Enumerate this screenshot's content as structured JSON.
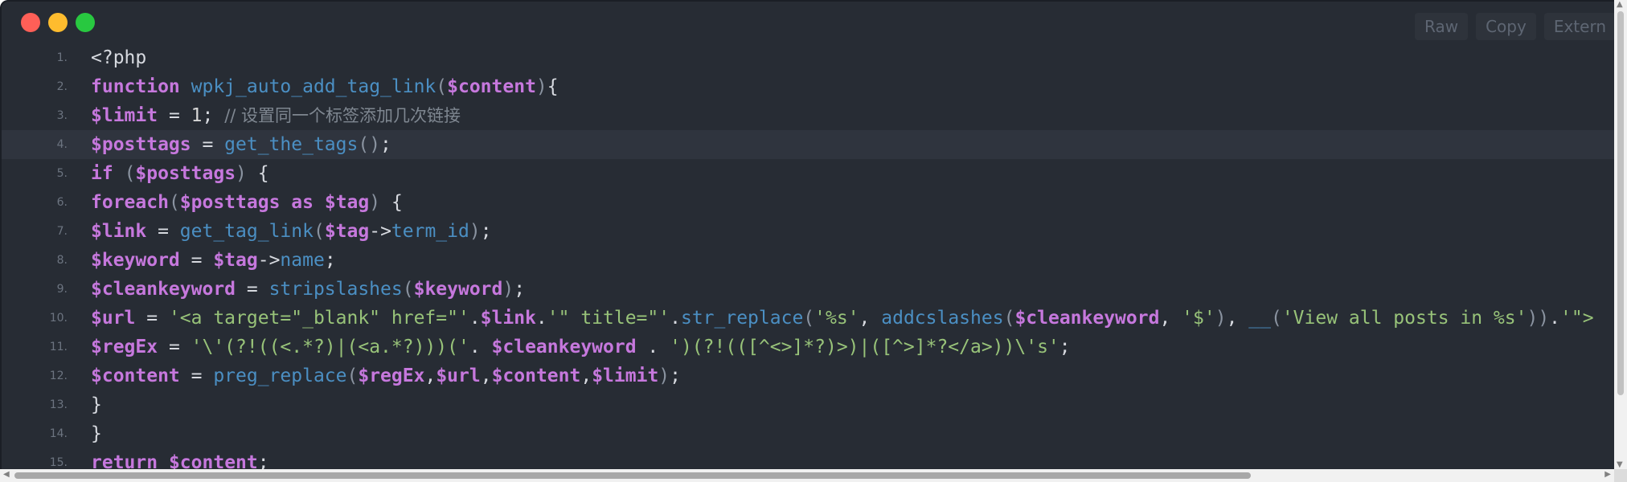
{
  "toolbar": {
    "raw_label": "Raw",
    "copy_label": "Copy",
    "extern_label": "Extern"
  },
  "code": {
    "lines": [
      {
        "n": "1.",
        "t": [
          [
            "pl",
            "<?php"
          ]
        ]
      },
      {
        "n": "2.",
        "t": [
          [
            "kw",
            "function"
          ],
          [
            "pl",
            " "
          ],
          [
            "fn",
            "wpkj_auto_add_tag_link"
          ],
          [
            "pn",
            "("
          ],
          [
            "var",
            "$content"
          ],
          [
            "pn",
            ")"
          ],
          [
            "pl",
            "{"
          ]
        ]
      },
      {
        "n": "3.",
        "t": [
          [
            "var",
            "$limit"
          ],
          [
            "pl",
            " = "
          ],
          [
            "num",
            "1"
          ],
          [
            "pl",
            "; "
          ],
          [
            "cm",
            "// 设置同一个标签添加几次链接"
          ]
        ]
      },
      {
        "n": "4.",
        "t": [
          [
            "var",
            "$posttags"
          ],
          [
            "pl",
            " = "
          ],
          [
            "fn",
            "get_the_tags"
          ],
          [
            "pn",
            "()"
          ],
          [
            "pl",
            ";"
          ]
        ]
      },
      {
        "n": "5.",
        "t": [
          [
            "kw",
            "if"
          ],
          [
            "pl",
            " "
          ],
          [
            "pn",
            "("
          ],
          [
            "var",
            "$posttags"
          ],
          [
            "pn",
            ")"
          ],
          [
            "pl",
            " {"
          ]
        ]
      },
      {
        "n": "6.",
        "t": [
          [
            "kw",
            "foreach"
          ],
          [
            "pn",
            "("
          ],
          [
            "var",
            "$posttags"
          ],
          [
            "pl",
            " "
          ],
          [
            "kw",
            "as"
          ],
          [
            "pl",
            " "
          ],
          [
            "var",
            "$tag"
          ],
          [
            "pn",
            ")"
          ],
          [
            "pl",
            " {"
          ]
        ]
      },
      {
        "n": "7.",
        "t": [
          [
            "var",
            "$link"
          ],
          [
            "pl",
            " = "
          ],
          [
            "fn",
            "get_tag_link"
          ],
          [
            "pn",
            "("
          ],
          [
            "var",
            "$tag"
          ],
          [
            "pl",
            "->"
          ],
          [
            "fn",
            "term_id"
          ],
          [
            "pn",
            ")"
          ],
          [
            "pl",
            ";"
          ]
        ]
      },
      {
        "n": "8.",
        "t": [
          [
            "var",
            "$keyword"
          ],
          [
            "pl",
            " = "
          ],
          [
            "var",
            "$tag"
          ],
          [
            "pl",
            "->"
          ],
          [
            "fn",
            "name"
          ],
          [
            "pl",
            ";"
          ]
        ]
      },
      {
        "n": "9.",
        "t": [
          [
            "var",
            "$cleankeyword"
          ],
          [
            "pl",
            " = "
          ],
          [
            "fn",
            "stripslashes"
          ],
          [
            "pn",
            "("
          ],
          [
            "var",
            "$keyword"
          ],
          [
            "pn",
            ")"
          ],
          [
            "pl",
            ";"
          ]
        ]
      },
      {
        "n": "10.",
        "t": [
          [
            "var",
            "$url"
          ],
          [
            "pl",
            " = "
          ],
          [
            "str",
            "'<a target=\"_blank\" href=\"'"
          ],
          [
            "pl",
            "."
          ],
          [
            "var",
            "$link"
          ],
          [
            "pl",
            "."
          ],
          [
            "str",
            "'\" title=\"'"
          ],
          [
            "pl",
            "."
          ],
          [
            "fn",
            "str_replace"
          ],
          [
            "pn",
            "("
          ],
          [
            "str",
            "'%s'"
          ],
          [
            "pl",
            ", "
          ],
          [
            "fn",
            "addcslashes"
          ],
          [
            "pn",
            "("
          ],
          [
            "var",
            "$cleankeyword"
          ],
          [
            "pl",
            ", "
          ],
          [
            "str",
            "'$'"
          ],
          [
            "pn",
            ")"
          ],
          [
            "pl",
            ", "
          ],
          [
            "fn",
            "__"
          ],
          [
            "pn",
            "("
          ],
          [
            "str",
            "'View all posts in %s'"
          ],
          [
            "pn",
            "))"
          ],
          [
            "pl",
            "."
          ],
          [
            "str",
            "'\">"
          ]
        ]
      },
      {
        "n": "11.",
        "t": [
          [
            "var",
            "$regEx"
          ],
          [
            "pl",
            " = "
          ],
          [
            "str",
            "'\\'(?!((<.*?)|(<a.*?)))('"
          ],
          [
            "pl",
            "."
          ],
          [
            "pl",
            " "
          ],
          [
            "var",
            "$cleankeyword"
          ],
          [
            "pl",
            " . "
          ],
          [
            "str",
            "')(?!(([^<>]*?)>)|([^>]*?</a>))\\'s'"
          ],
          [
            "pl",
            ";"
          ]
        ]
      },
      {
        "n": "12.",
        "t": [
          [
            "var",
            "$content"
          ],
          [
            "pl",
            " = "
          ],
          [
            "fn",
            "preg_replace"
          ],
          [
            "pn",
            "("
          ],
          [
            "var",
            "$regEx"
          ],
          [
            "pl",
            ","
          ],
          [
            "var",
            "$url"
          ],
          [
            "pl",
            ","
          ],
          [
            "var",
            "$content"
          ],
          [
            "pl",
            ","
          ],
          [
            "var",
            "$limit"
          ],
          [
            "pn",
            ")"
          ],
          [
            "pl",
            ";"
          ]
        ]
      },
      {
        "n": "13.",
        "t": [
          [
            "pl",
            "}"
          ]
        ]
      },
      {
        "n": "14.",
        "t": [
          [
            "pl",
            "}"
          ]
        ]
      },
      {
        "n": "15.",
        "t": [
          [
            "kw",
            "return"
          ],
          [
            "pl",
            " "
          ],
          [
            "var",
            "$content"
          ],
          [
            "pl",
            ";"
          ]
        ]
      }
    ],
    "highlighted_line": 4
  }
}
